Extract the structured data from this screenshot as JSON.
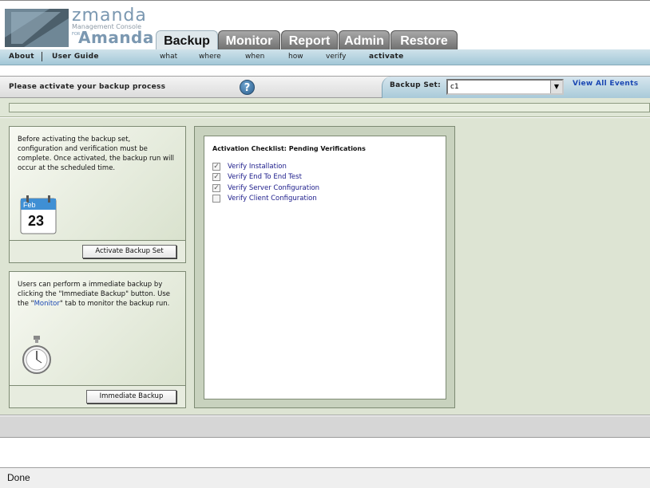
{
  "logo": {
    "brand": "zmanda",
    "subtitle": "Management Console",
    "for_text": "FOR",
    "product": "Amanda"
  },
  "tabs": [
    {
      "label": "Backup",
      "active": true
    },
    {
      "label": "Monitor",
      "active": false
    },
    {
      "label": "Report",
      "active": false
    },
    {
      "label": "Admin",
      "active": false
    },
    {
      "label": "Restore",
      "active": false
    }
  ],
  "nav": {
    "about": "About",
    "user_guide": "User Guide",
    "subtabs": [
      "what",
      "where",
      "when",
      "how",
      "verify",
      "activate"
    ],
    "active_subtab": "activate"
  },
  "activation_bar": {
    "title": "Please activate your backup process",
    "help_icon": "?",
    "backup_set_label": "Backup Set:",
    "backup_set_value": "c1",
    "view_all_events": "View All Events"
  },
  "activate_panel": {
    "text": "Before activating the backup set, configuration and verification must be complete. Once activated, the backup run will occur at the scheduled time.",
    "calendar_month": "Feb",
    "calendar_day": "23",
    "button": "Activate Backup Set"
  },
  "immediate_panel": {
    "text_before": "Users can perform a immediate backup by clicking the \"Immediate Backup\" button. Use the \"",
    "link": "Monitor",
    "text_after": "\" tab to monitor the backup run.",
    "button": "Immediate Backup"
  },
  "checklist": {
    "heading": "Activation Checklist: Pending Verifications",
    "items": [
      {
        "label": "Verify Installation",
        "checked": true
      },
      {
        "label": "Verify End To End Test",
        "checked": true
      },
      {
        "label": "Verify Server Configuration",
        "checked": true
      },
      {
        "label": "Verify Client Configuration",
        "checked": false
      }
    ]
  },
  "status_bar": {
    "text": "Done"
  },
  "colors": {
    "accent_blue": "#1b48b3",
    "main_bg": "#dde4d3",
    "nav_bg": "#a3c8d8"
  }
}
